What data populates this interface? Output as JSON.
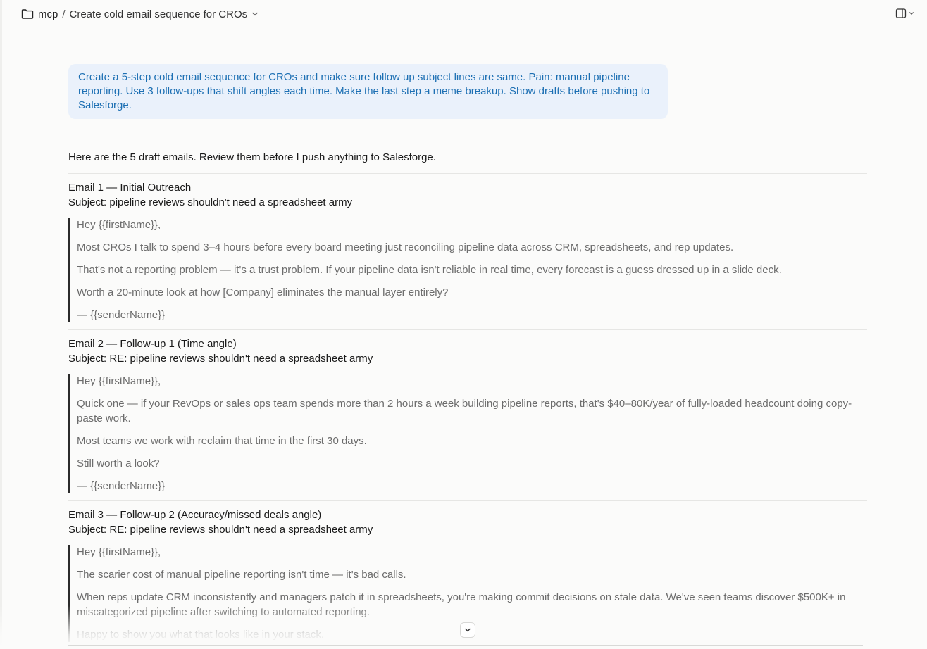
{
  "header": {
    "project": "mcp",
    "separator": "/",
    "title": "Create cold email sequence for CROs",
    "folder_icon": "folder-icon",
    "chevron_icon": "chevron-down-icon",
    "panel_icon": "sidebar-panel-icon"
  },
  "prompt": {
    "text": "Create a 5-step cold email sequence for CROs and make sure follow up subject lines are same. Pain: manual pipeline reporting. Use 3 follow-ups that shift angles each time. Make the last step a meme breakup. Show drafts before pushing to Salesforge."
  },
  "answer": {
    "intro": "Here are the 5 draft emails. Review them before I push anything to Salesforge.",
    "emails": [
      {
        "heading": "Email 1 — Initial Outreach",
        "subject": "Subject: pipeline reviews shouldn't need a spreadsheet army",
        "lines": [
          "Hey {{firstName}},",
          "Most CROs I talk to spend 3–4 hours before every board meeting just reconciling pipeline data across CRM, spreadsheets, and rep updates.",
          "That's not a reporting problem — it's a trust problem. If your pipeline data isn't reliable in real time, every forecast is a guess dressed up in a slide deck.",
          "Worth a 20-minute look at how [Company] eliminates the manual layer entirely?",
          "— {{senderName}}"
        ]
      },
      {
        "heading": "Email 2 — Follow-up 1 (Time angle)",
        "subject": "Subject: RE: pipeline reviews shouldn't need a spreadsheet army",
        "lines": [
          "Hey {{firstName}},",
          "Quick one — if your RevOps or sales ops team spends more than 2 hours a week building pipeline reports, that's $40–80K/year of fully-loaded headcount doing copy-paste work.",
          "Most teams we work with reclaim that time in the first 30 days.",
          "Still worth a look?",
          "— {{senderName}}"
        ]
      },
      {
        "heading": "Email 3 — Follow-up 2 (Accuracy/missed deals angle)",
        "subject": "Subject: RE: pipeline reviews shouldn't need a spreadsheet army",
        "lines": [
          "Hey {{firstName}},",
          "The scarier cost of manual pipeline reporting isn't time — it's bad calls.",
          "When reps update CRM inconsistently and managers patch it in spreadsheets, you're making commit decisions on stale data. We've seen teams discover $500K+ in miscategorized pipeline after switching to automated reporting.",
          "Happy to show you what that looks like in your stack."
        ]
      }
    ]
  },
  "scroll_icon": "chevron-down-icon"
}
